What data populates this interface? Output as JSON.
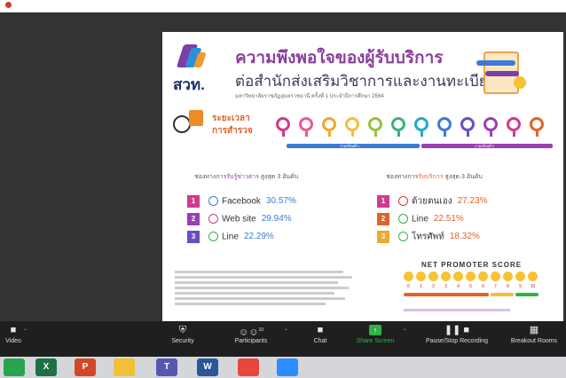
{
  "top_bar": {
    "indicator_text": ""
  },
  "slide": {
    "logo_text": "สวท.",
    "title_line1": "ความพึงพอใจของผู้รับบริการ",
    "title_line2": "ต่อสำนักส่งเสริมวิชาการและงานทะเบียน",
    "subtitle": "มหาวิทยาลัยราชภัฏอุบลราชธานี ครั้งที่ 1 ประจำปีการศึกษา 2564",
    "period_label_1": "ระยะเวลา",
    "period_label_2": "การสำรวจ",
    "timeline": {
      "segment1": "ภาคเรียนที่ 1",
      "segment2": "ภาคเรียนที่ 2"
    },
    "news_header_prefix": "ช่องทางการ",
    "news_header_highlight": "รับรู้ข่าวสาร",
    "news_header_suffix": " สูงสุด 3 อันดับ",
    "service_header_prefix": "ช่องทางการ",
    "service_header_highlight": "รับบริการ",
    "service_header_suffix": " สูงสุด 3 อันดับ",
    "news_channels": [
      {
        "rank": "1",
        "name": "Facebook",
        "percent": "30.57%",
        "icon": "facebook-icon"
      },
      {
        "rank": "2",
        "name": "Web site",
        "percent": "29.94%",
        "icon": "globe-icon"
      },
      {
        "rank": "3",
        "name": "Line",
        "percent": "22.29%",
        "icon": "line-icon"
      }
    ],
    "service_channels": [
      {
        "rank": "1",
        "name": "ด้วยตนเอง",
        "percent": "27.23%",
        "icon": "walk-in-icon"
      },
      {
        "rank": "2",
        "name": "Line",
        "percent": "22.51%",
        "icon": "line-icon"
      },
      {
        "rank": "3",
        "name": "โทรศัพท์",
        "percent": "18.32%",
        "icon": "phone-icon"
      }
    ],
    "nps_title": "NET PROMOTER SCORE",
    "nps_scale": [
      "0",
      "1",
      "2",
      "3",
      "4",
      "5",
      "6",
      "7",
      "8",
      "9",
      "10"
    ]
  },
  "toolbar": {
    "video": "Video",
    "security": "Security",
    "participants": "Participants",
    "participants_count": "10",
    "chat": "Chat",
    "share_screen": "Share Screen",
    "pause_recording": "Pause/Stop Recording",
    "breakout_rooms": "Breakout Rooms"
  },
  "taskbar_apps": [
    {
      "name": "chrome-like-app",
      "letter": "",
      "color": "#2aa44f"
    },
    {
      "name": "excel",
      "letter": "X",
      "color": "#1e7145"
    },
    {
      "name": "powerpoint",
      "letter": "P",
      "color": "#d24726"
    },
    {
      "name": "file-explorer",
      "letter": "",
      "color": "#f2c037"
    },
    {
      "name": "teams",
      "letter": "T",
      "color": "#5558af"
    },
    {
      "name": "word",
      "letter": "W",
      "color": "#2b579a"
    },
    {
      "name": "chrome",
      "letter": "",
      "color": "#e8453c"
    },
    {
      "name": "zoom",
      "letter": "",
      "color": "#2d8cff"
    }
  ],
  "colors": {
    "accent_purple": "#8a3f9e",
    "accent_orange": "#e0632a",
    "news_pct": "#3b7bd6",
    "service_pct": "#e0632a",
    "share_green": "#2fb344"
  }
}
